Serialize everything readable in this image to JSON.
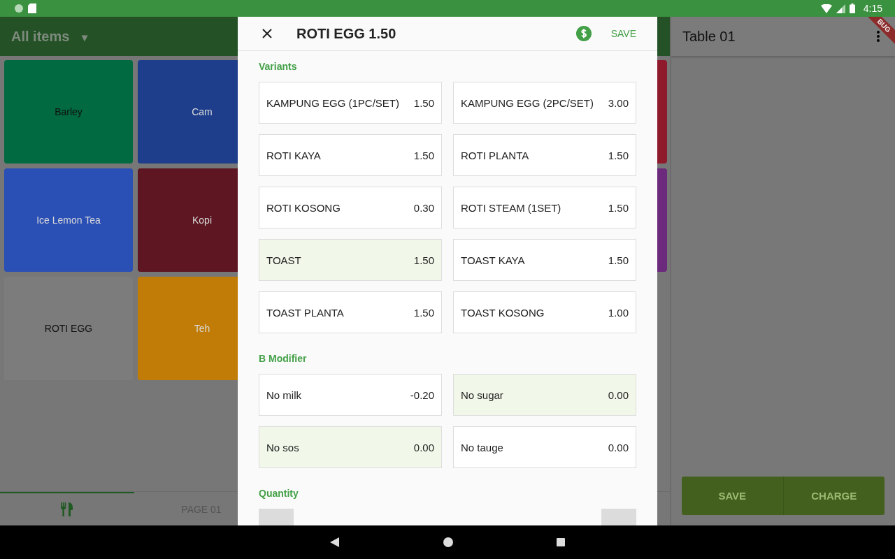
{
  "status_bar": {
    "time": "4:15"
  },
  "menu": {
    "title": "All items",
    "caret": "▾"
  },
  "tiles": [
    {
      "kind": "tile",
      "label": "Barley",
      "color": "#016a40",
      "dimmed": false
    },
    {
      "kind": "tile",
      "label": "Cam",
      "color": "#1e3e8c",
      "dimmed": true
    },
    {
      "kind": "edge",
      "color": "#8e1a2b"
    },
    {
      "kind": "tile",
      "label": "Ice Lemon Tea",
      "color": "#2a4fb5",
      "dimmed": true
    },
    {
      "kind": "tile",
      "label": "Kopi",
      "color": "#5d1622",
      "dimmed": true
    },
    {
      "kind": "edge",
      "color": "#6b2a7c"
    },
    {
      "kind": "tile",
      "label": "ROTI EGG",
      "color": "#7c7c7c",
      "dimmed": false
    },
    {
      "kind": "tile",
      "label": "Teh",
      "color": "#c07c06",
      "dimmed": true
    }
  ],
  "bottom_tabs": [
    {
      "kind": "icon",
      "selected": true
    },
    {
      "kind": "text",
      "label": "PAGE 01",
      "selected": false
    }
  ],
  "order": {
    "title": "Table 01",
    "buttons": [
      "SAVE",
      "CHARGE"
    ]
  },
  "debug_banner": "BUG",
  "dialog": {
    "title": "ROTI EGG 1.50",
    "save": "SAVE",
    "sections": [
      {
        "title": "Variants",
        "options": [
          {
            "name": "KAMPUNG EGG (1PC/SET)",
            "price": "1.50",
            "selected": false
          },
          {
            "name": "KAMPUNG EGG (2PC/SET)",
            "price": "3.00",
            "selected": false
          },
          {
            "name": "ROTI KAYA",
            "price": "1.50",
            "selected": false
          },
          {
            "name": "ROTI PLANTA",
            "price": "1.50",
            "selected": false
          },
          {
            "name": "ROTI KOSONG",
            "price": "0.30",
            "selected": false
          },
          {
            "name": "ROTI STEAM (1SET)",
            "price": "1.50",
            "selected": false
          },
          {
            "name": "TOAST",
            "price": "1.50",
            "selected": true
          },
          {
            "name": "TOAST KAYA",
            "price": "1.50",
            "selected": false
          },
          {
            "name": "TOAST PLANTA",
            "price": "1.50",
            "selected": false
          },
          {
            "name": "TOAST KOSONG",
            "price": "1.00",
            "selected": false
          }
        ]
      },
      {
        "title": "B Modifier",
        "options": [
          {
            "name": "No milk",
            "price": "-0.20",
            "selected": false
          },
          {
            "name": "No sugar",
            "price": "0.00",
            "selected": true
          },
          {
            "name": "No sos",
            "price": "0.00",
            "selected": true
          },
          {
            "name": "No tauge",
            "price": "0.00",
            "selected": false
          }
        ]
      }
    ],
    "quantity": {
      "title": "Quantity"
    }
  }
}
